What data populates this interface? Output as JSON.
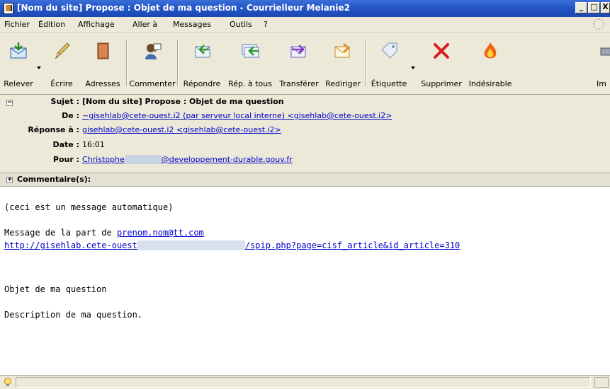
{
  "window": {
    "title": "[Nom du site] Propose : Objet de ma question - Courrielleur Melanie2",
    "controls": [
      "_",
      "□",
      "X"
    ]
  },
  "menu": [
    "Fichier",
    "Édition",
    "Affichage",
    "Aller à",
    "Messages",
    "Outils",
    "?"
  ],
  "toolbar": {
    "releve": "Relever",
    "ecrire": "Écrire",
    "adresses": "Adresses",
    "commenter": "Commenter",
    "repondre": "Répondre",
    "rep_tous": "Rép. à tous",
    "transferer": "Transférer",
    "rediriger": "Rediriger",
    "etiquette": "Étiquette",
    "supprimer": "Supprimer",
    "indesirable": "Indésirable",
    "imprimer_partial": "Im"
  },
  "headers": {
    "sujet_label": "Sujet :",
    "sujet_value": "[Nom du site] Propose : Objet de ma question",
    "de_label": "De :",
    "de_value": "~gisehlab@cete-ouest.i2 (par serveur local interne) <gisehlab@cete-ouest.i2>",
    "reponse_label": "Réponse à :",
    "reponse_value": "gisehlab@cete-ouest.i2 <gisehlab@cete-ouest.i2>",
    "date_label": "Date :",
    "date_value": "16:01",
    "pour_label": "Pour :",
    "pour_name": "Christophe",
    "pour_domain": "@developpement-durable.gouv.fr",
    "commentaires_label": "Commentaire(s):"
  },
  "body": {
    "line1": "(ceci est un message automatique)",
    "line2_prefix": "Message de la part de ",
    "line2_link": "prenom.nom@tt.com",
    "line3_link_start": "http://gisehlab.cete-ouest",
    "line3_link_end": "/spip.php?page=cisf_article&id_article=310",
    "line4": "Objet de ma question",
    "line5": "Description de ma question."
  },
  "colors": {
    "titlebar": "#2456c8",
    "link": "#0000cc",
    "chrome": "#ece9d8"
  }
}
